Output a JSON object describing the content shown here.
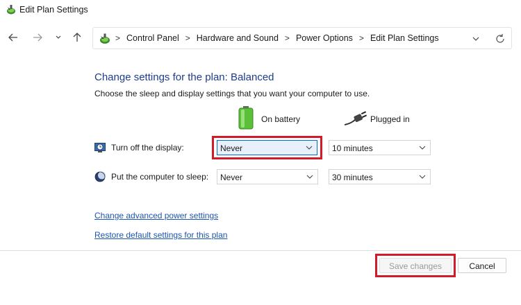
{
  "window": {
    "title": "Edit Plan Settings",
    "icon": "power-options-icon"
  },
  "nav": {
    "back_icon": "arrow-left-icon",
    "forward_icon": "arrow-right-icon",
    "recent_icon": "chevron-down-icon",
    "up_icon": "arrow-up-icon"
  },
  "address": {
    "crumbs": [
      "Control Panel",
      "Hardware and Sound",
      "Power Options",
      "Edit Plan Settings"
    ],
    "dropdown_icon": "chevron-down-icon",
    "refresh_icon": "refresh-icon"
  },
  "main": {
    "heading": "Change settings for the plan: Balanced",
    "subheading": "Choose the sleep and display settings that you want your computer to use.",
    "columns": {
      "battery": "On battery",
      "plugged": "Plugged in"
    },
    "rows": [
      {
        "label": "Turn off the display:",
        "icon": "display-timer-icon",
        "battery_value": "Never",
        "plugged_value": "10 minutes"
      },
      {
        "label": "Put the computer to sleep:",
        "icon": "sleep-moon-icon",
        "battery_value": "Never",
        "plugged_value": "30 minutes"
      }
    ],
    "links": {
      "advanced": "Change advanced power settings",
      "restore": "Restore default settings for this plan"
    }
  },
  "footer": {
    "save_label": "Save changes",
    "cancel_label": "Cancel"
  },
  "colors": {
    "heading": "#1e3c8c",
    "link": "#1a55b0",
    "highlight_box": "#d11a2a"
  }
}
